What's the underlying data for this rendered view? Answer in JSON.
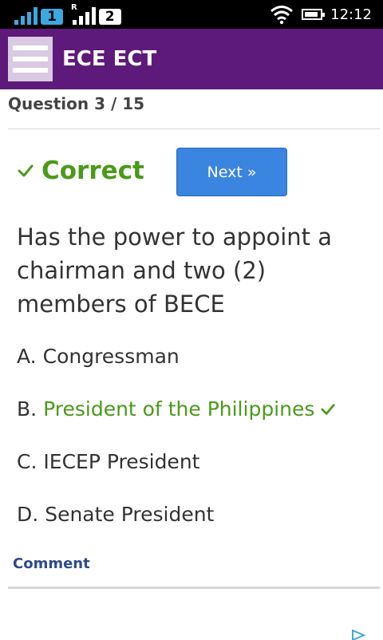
{
  "status_bar": {
    "sim1": "1",
    "sim2": "2",
    "roaming": "R",
    "time": "12:12",
    "icons": [
      "signal-icon",
      "wifi-icon",
      "battery-icon"
    ]
  },
  "app_bar": {
    "title": "ECE ECT",
    "color": "#5e1a7a"
  },
  "quiz": {
    "counter": "Question 3 / 15",
    "result": "Correct",
    "next_label": "Next »",
    "question": "Has the power to appoint a chairman and two (2) members of BECE",
    "answers": [
      {
        "letter": "A.",
        "text": "Congressman",
        "correct": false
      },
      {
        "letter": "B.",
        "text": "President of the Philippines",
        "correct": true
      },
      {
        "letter": "C.",
        "text": "IECEP President",
        "correct": false
      },
      {
        "letter": "D.",
        "text": "Senate President",
        "correct": false
      }
    ],
    "comment_label": "Comment"
  },
  "colors": {
    "correct": "#4a9a1a",
    "button": "#3a85e0",
    "link": "#2f4a8a"
  }
}
